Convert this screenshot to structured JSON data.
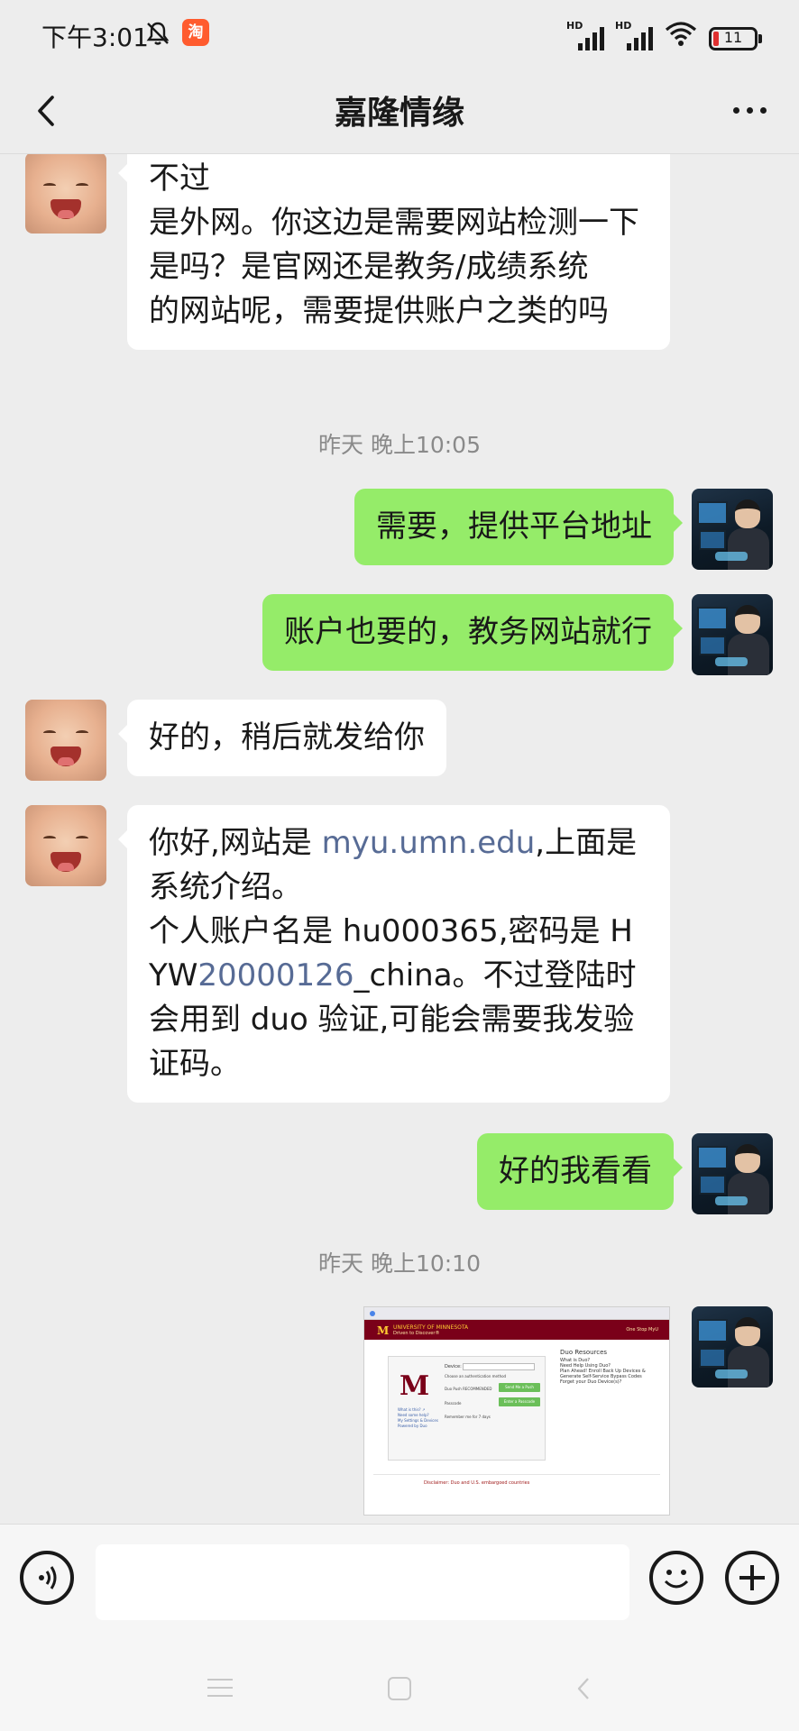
{
  "status_bar": {
    "time": "下午3:01",
    "app_badge": "淘",
    "signal1": "HD",
    "signal2": "HD",
    "battery": "11",
    "battery_color": "#e03030"
  },
  "nav": {
    "title": "嘉隆情缘",
    "back_icon": "chevron-left-icon",
    "more_icon": "more-dots-icon"
  },
  "messages": [
    {
      "side": "left",
      "text": "不过\n是外网。你这边是需要网站检测一下是吗？是官网还是教务/成绩系统\n的网站呢，需要提供账户之类的吗"
    },
    {
      "side": "right",
      "text": "需要，提供平台地址"
    },
    {
      "side": "right",
      "text": "账户也要的，教务网站就行"
    },
    {
      "side": "left",
      "text": "好的，稍后就发给你"
    },
    {
      "side": "left",
      "parts": {
        "p1": "你好,网站是 ",
        "link1": "myu.umn.edu",
        "p2": ",上面是系统介绍。\n个人账户名是 hu000365,密码是 HYW",
        "link2": "20000126",
        "p3": "_china。不过登陆时会用到 duo 验证,可能会需要我发验证码。"
      }
    },
    {
      "side": "right",
      "text": "好的我看看"
    }
  ],
  "time_separators": [
    "昨天 晚上10:05",
    "昨天 晚上10:10"
  ],
  "screenshot": {
    "logo_letter": "M",
    "univ_name": "UNIVERSITY OF MINNESOTA",
    "univ_tagline": "Driven to Discover®",
    "header_links": "One Stop   MyU",
    "device_label": "Device:",
    "option1": "Choose an authentication method",
    "option2": "Duo Push RECOMMENDED",
    "option3": "Passcode",
    "option4": "Remember me for 7 days",
    "btn1": "Send Me a Push",
    "btn2": "Enter a Passcode",
    "left_links": "What is this? ↗\nNeed some help?\nMy Settings & Devices\nPowered by Duo",
    "resources_title": "Duo Resources",
    "resources": "What is Duo?\nNeed Help Using Duo?\nPlan Ahead! Enroll Back Up Devices & Generate Self-Service Bypass Codes\nForget your Duo Device(s)?",
    "disclaimer": "Disclaimer: Duo and U.S. embargoed countries"
  },
  "input": {
    "placeholder": ""
  },
  "colors": {
    "bg": "#ededed",
    "bubble_right": "#95ec69",
    "bubble_left": "#ffffff",
    "link": "#576b95"
  }
}
